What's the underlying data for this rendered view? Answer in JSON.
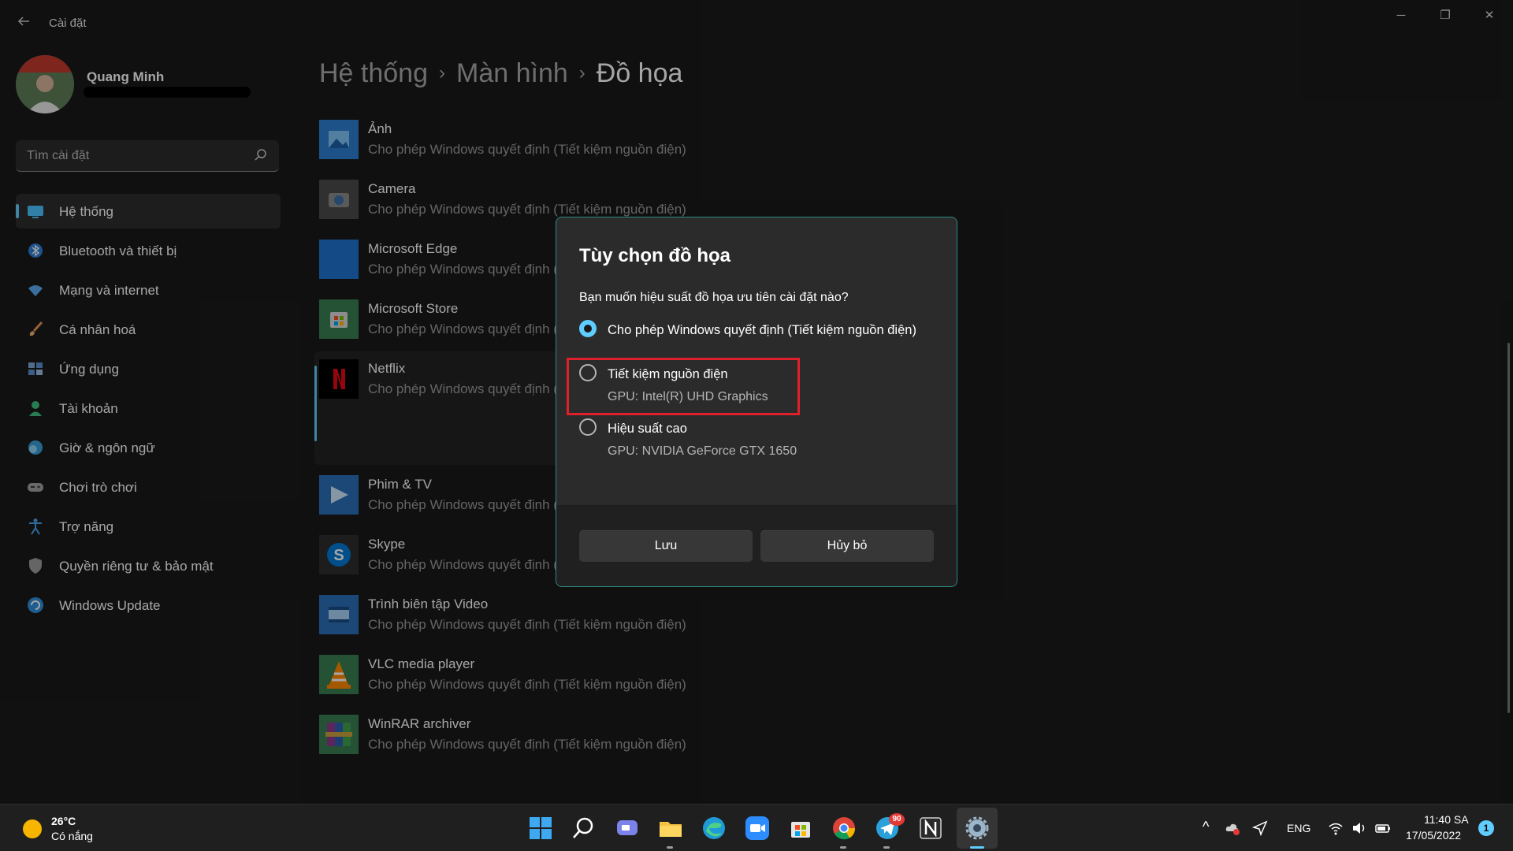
{
  "window": {
    "app_title": "Cài đặt",
    "minimize": "─",
    "restore": "❐",
    "close": "✕"
  },
  "profile": {
    "name": "Quang Minh"
  },
  "search": {
    "placeholder": "Tìm cài đặt"
  },
  "sidebar": {
    "items": [
      {
        "label": "Hệ thống",
        "icon": "monitor-icon",
        "color": "#4cc2ff",
        "active": true
      },
      {
        "label": "Bluetooth và thiết bị",
        "icon": "bluetooth-icon",
        "color": "#3a8ee6"
      },
      {
        "label": "Mạng và internet",
        "icon": "wifi-icon",
        "color": "#5aa9f0"
      },
      {
        "label": "Cá nhân hoá",
        "icon": "brush-icon",
        "color": "#e8965a"
      },
      {
        "label": "Ứng dụng",
        "icon": "apps-icon",
        "color": "#7ea7d8"
      },
      {
        "label": "Tài khoản",
        "icon": "person-icon",
        "color": "#3fbf7f"
      },
      {
        "label": "Giờ & ngôn ngữ",
        "icon": "globe-clock-icon",
        "color": "#3a9fd8"
      },
      {
        "label": "Chơi trò chơi",
        "icon": "gamepad-icon",
        "color": "#a0a0a0"
      },
      {
        "label": "Trợ năng",
        "icon": "accessibility-icon",
        "color": "#4aa3f0"
      },
      {
        "label": "Quyền riêng tư & bảo mật",
        "icon": "shield-icon",
        "color": "#9c9c9c"
      },
      {
        "label": "Windows Update",
        "icon": "refresh-icon",
        "color": "#2f8fdc"
      }
    ]
  },
  "breadcrumb": {
    "level1": "Hệ thống",
    "level2": "Màn hình",
    "current": "Đồ họa",
    "separator": "›"
  },
  "apps": [
    {
      "name": "Ảnh",
      "desc": "Cho phép Windows quyết định (Tiết kiệm nguồn điện)",
      "icon": "photos-icon",
      "color": "#2b7fd0"
    },
    {
      "name": "Camera",
      "desc": "Cho phép Windows quyết định (Tiết kiệm nguồn điện)",
      "icon": "camera-icon",
      "color": "#4a4a4a"
    },
    {
      "name": "Microsoft Edge",
      "desc": "Cho phép Windows quyết định (Tiết kiệm nguồn điện)",
      "icon": "edge-icon",
      "color": "#1f73d0"
    },
    {
      "name": "Microsoft Store",
      "desc": "Cho phép Windows quyết định (Tiết kiệm nguồn điện)",
      "icon": "store-icon",
      "color": "#3a7d52"
    },
    {
      "name": "Netflix",
      "desc": "Cho phép Windows quyết định (Tiết kiệm nguồn điện)",
      "icon": "netflix-icon",
      "color": "#000000",
      "expanded": true
    },
    {
      "name": "Phim & TV",
      "desc": "Cho phép Windows quyết định (Tiết kiệm nguồn điện)",
      "icon": "movies-icon",
      "color": "#2b6fb8"
    },
    {
      "name": "Skype",
      "desc": "Cho phép Windows quyết định (Tiết kiệm nguồn điện)",
      "icon": "skype-icon",
      "color": "#2d2d2d"
    },
    {
      "name": "Trình biên tập Video",
      "desc": "Cho phép Windows quyết định (Tiết kiệm nguồn điện)",
      "icon": "video-editor-icon",
      "color": "#2b6fb8"
    },
    {
      "name": "VLC media player",
      "desc": "Cho phép Windows quyết định (Tiết kiệm nguồn điện)",
      "icon": "vlc-icon",
      "color": "#3a7d52"
    },
    {
      "name": "WinRAR archiver",
      "desc": "Cho phép Windows quyết định (Tiết kiệm nguồn điện)",
      "icon": "winrar-icon",
      "color": "#3a7d52"
    }
  ],
  "dialog": {
    "title": "Tùy chọn đồ họa",
    "question": "Bạn muốn hiệu suất đồ họa ưu tiên cài đặt nào?",
    "options": [
      {
        "label": "Cho phép Windows quyết định (Tiết kiệm nguồn điện)",
        "sub": "",
        "checked": true
      },
      {
        "label": "Tiết kiệm nguồn điện",
        "sub": "GPU: Intel(R) UHD Graphics",
        "checked": false,
        "highlighted": true
      },
      {
        "label": "Hiệu suất cao",
        "sub": "GPU: NVIDIA GeForce GTX 1650",
        "checked": false
      }
    ],
    "save_label": "Lưu",
    "cancel_label": "Hủy bỏ",
    "accent": "#60cdff",
    "highlight_color": "#e0202a"
  },
  "taskbar": {
    "temperature": "26°C",
    "weather": "Có nắng",
    "telegram_badge": "90",
    "language": "ENG",
    "time": "11:40 SA",
    "date": "17/05/2022",
    "notification_count": "1"
  }
}
